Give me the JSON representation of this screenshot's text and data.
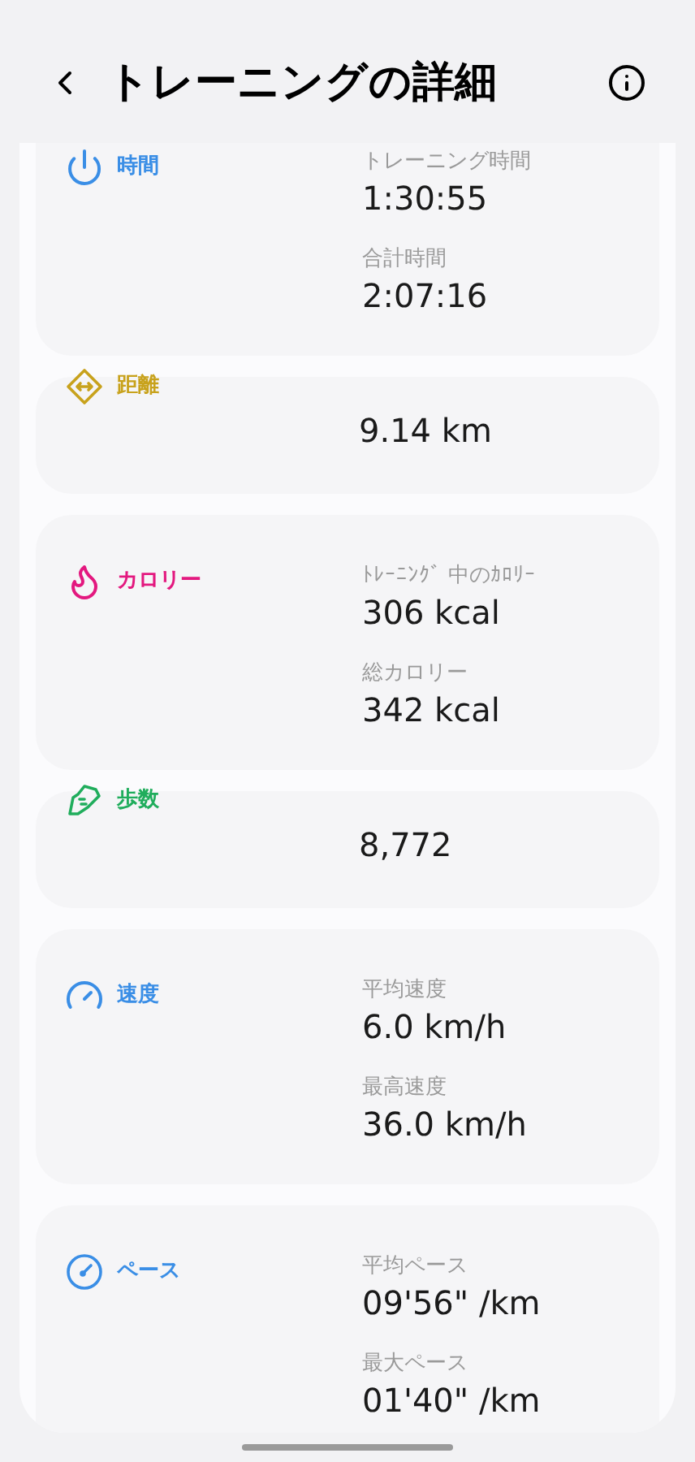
{
  "header": {
    "title": "トレーニングの詳細"
  },
  "cards": [
    {
      "kind": "time",
      "label": "時間",
      "color": "#3a8ee6",
      "entries": [
        {
          "label": "トレーニング時間",
          "value": "1:30:55"
        },
        {
          "label": "合計時間",
          "value": "2:07:16"
        }
      ]
    },
    {
      "kind": "distance",
      "label": "距離",
      "color": "#c8a21c",
      "entries": [
        {
          "value": "9.14 km"
        }
      ]
    },
    {
      "kind": "calories",
      "label": "カロリー",
      "color": "#e3187f",
      "entries": [
        {
          "label": "ﾄﾚｰﾆﾝｸﾞ 中のｶﾛﾘｰ",
          "value": "306 kcal"
        },
        {
          "label": "総カロリー",
          "value": "342 kcal"
        }
      ]
    },
    {
      "kind": "steps",
      "label": "歩数",
      "color": "#20ad5c",
      "entries": [
        {
          "value": "8,772"
        }
      ]
    },
    {
      "kind": "speed",
      "label": "速度",
      "color": "#3a8ee6",
      "entries": [
        {
          "label": "平均速度",
          "value": "6.0 km/h"
        },
        {
          "label": "最高速度",
          "value": "36.0 km/h"
        }
      ]
    },
    {
      "kind": "pace",
      "label": "ペース",
      "color": "#3a8ee6",
      "entries": [
        {
          "label": "平均ペース",
          "value": "09'56\" /km"
        },
        {
          "label": "最大ペース",
          "value": "01'40\" /km"
        }
      ]
    }
  ]
}
